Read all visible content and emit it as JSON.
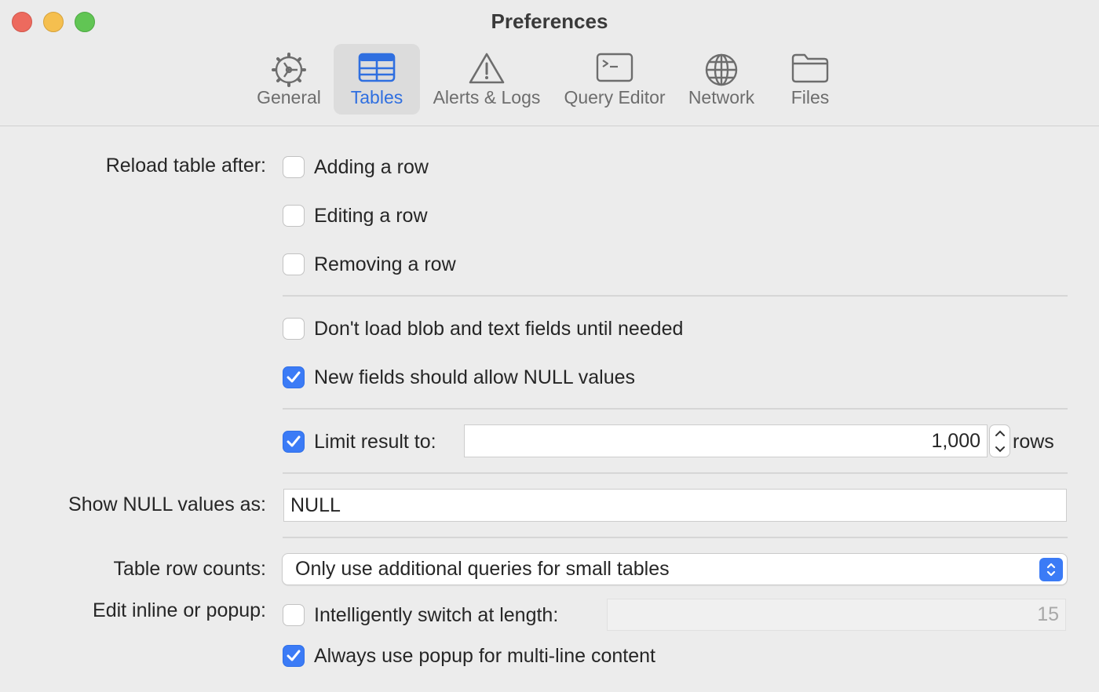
{
  "window": {
    "title": "Preferences"
  },
  "colors": {
    "accent": "#3b7bf6",
    "active_tab_text": "#2f6fe0"
  },
  "toolbar": {
    "tabs": [
      {
        "label": "General",
        "icon": "gear-icon"
      },
      {
        "label": "Tables",
        "icon": "table-icon",
        "active": true
      },
      {
        "label": "Alerts & Logs",
        "icon": "warning-icon"
      },
      {
        "label": "Query Editor",
        "icon": "terminal-icon"
      },
      {
        "label": "Network",
        "icon": "globe-icon"
      },
      {
        "label": "Files",
        "icon": "folder-icon"
      }
    ]
  },
  "reload": {
    "label": "Reload table after:",
    "options": [
      {
        "label": "Adding a row",
        "checked": false
      },
      {
        "label": "Editing a row",
        "checked": false
      },
      {
        "label": "Removing a row",
        "checked": false
      }
    ]
  },
  "blob": {
    "label": "Don't load blob and text fields until needed",
    "checked": false
  },
  "null_fields": {
    "label": "New fields should allow NULL values",
    "checked": true
  },
  "limit": {
    "label": "Limit result to:",
    "checked": true,
    "value": "1,000",
    "unit": "rows"
  },
  "null_display": {
    "label": "Show NULL values as:",
    "value": "NULL"
  },
  "row_counts": {
    "label": "Table row counts:",
    "selected": "Only use additional queries for small tables"
  },
  "edit_inline": {
    "label": "Edit inline or popup:",
    "switch": {
      "label": "Intelligently switch at length:",
      "checked": false,
      "value": "15"
    },
    "popup": {
      "label": "Always use popup for multi-line content",
      "checked": true
    }
  }
}
